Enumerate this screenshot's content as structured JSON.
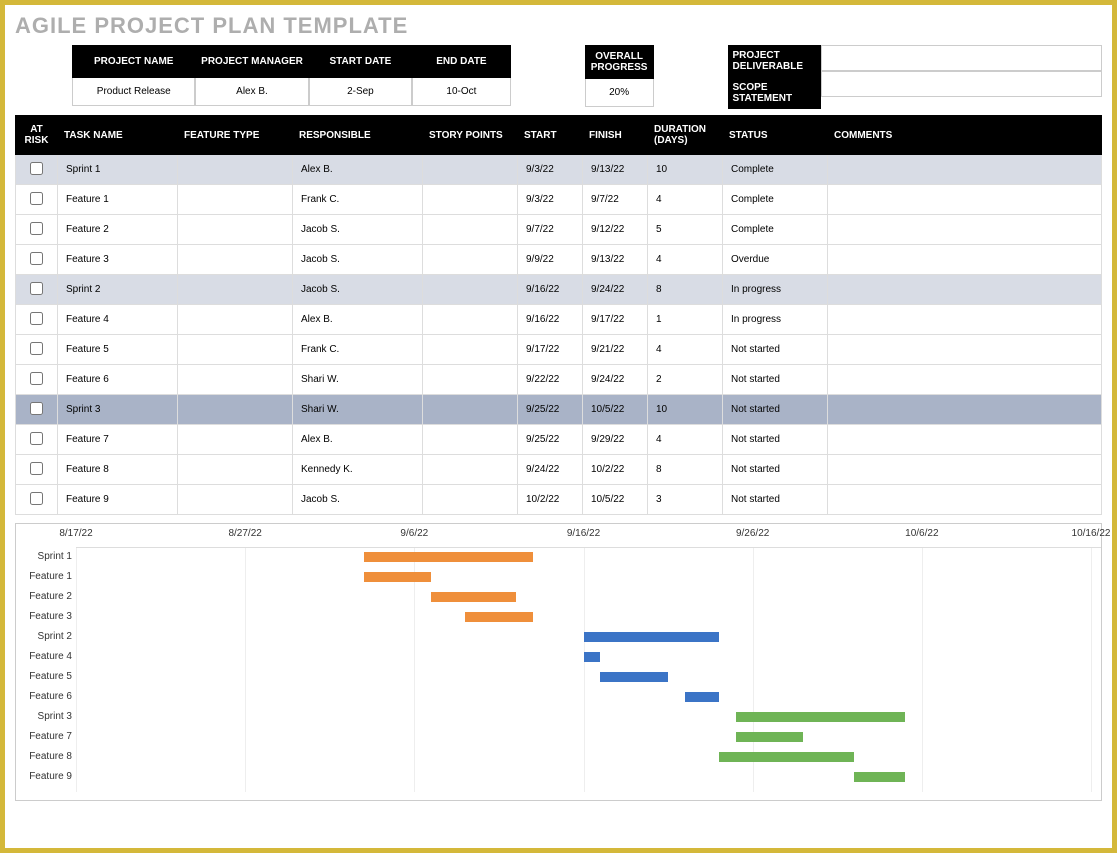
{
  "title": "AGILE PROJECT PLAN TEMPLATE",
  "header": {
    "project_name": {
      "label": "PROJECT NAME",
      "value": "Product Release"
    },
    "project_manager": {
      "label": "PROJECT MANAGER",
      "value": "Alex B."
    },
    "start_date": {
      "label": "START DATE",
      "value": "2-Sep"
    },
    "end_date": {
      "label": "END DATE",
      "value": "10-Oct"
    },
    "overall_progress": {
      "label": "OVERALL PROGRESS",
      "value": "20%"
    },
    "project_deliverable": {
      "label": "PROJECT DELIVERABLE",
      "value": ""
    },
    "scope_statement": {
      "label": "SCOPE STATEMENT",
      "value": ""
    }
  },
  "columns": {
    "at_risk": "AT RISK",
    "task_name": "TASK NAME",
    "feature_type": "FEATURE TYPE",
    "responsible": "RESPONSIBLE",
    "story_points": "STORY POINTS",
    "start": "START",
    "finish": "FINISH",
    "duration": "DURATION (DAYS)",
    "status": "STATUS",
    "comments": "COMMENTS"
  },
  "tasks": [
    {
      "type": "sprint-gray",
      "task": "Sprint 1",
      "resp": "Alex B.",
      "start": "9/3/22",
      "finish": "9/13/22",
      "dur": "10",
      "status": "Complete"
    },
    {
      "type": "",
      "task": "Feature 1",
      "resp": "Frank C.",
      "start": "9/3/22",
      "finish": "9/7/22",
      "dur": "4",
      "status": "Complete"
    },
    {
      "type": "",
      "task": "Feature 2",
      "resp": "Jacob S.",
      "start": "9/7/22",
      "finish": "9/12/22",
      "dur": "5",
      "status": "Complete"
    },
    {
      "type": "",
      "task": "Feature 3",
      "resp": "Jacob S.",
      "start": "9/9/22",
      "finish": "9/13/22",
      "dur": "4",
      "status": "Overdue"
    },
    {
      "type": "sprint-gray",
      "task": "Sprint 2",
      "resp": "Jacob S.",
      "start": "9/16/22",
      "finish": "9/24/22",
      "dur": "8",
      "status": "In progress"
    },
    {
      "type": "",
      "task": "Feature 4",
      "resp": "Alex B.",
      "start": "9/16/22",
      "finish": "9/17/22",
      "dur": "1",
      "status": "In progress"
    },
    {
      "type": "",
      "task": "Feature 5",
      "resp": "Frank C.",
      "start": "9/17/22",
      "finish": "9/21/22",
      "dur": "4",
      "status": "Not started"
    },
    {
      "type": "",
      "task": "Feature 6",
      "resp": "Shari W.",
      "start": "9/22/22",
      "finish": "9/24/22",
      "dur": "2",
      "status": "Not started"
    },
    {
      "type": "sprint-blue",
      "task": "Sprint 3",
      "resp": "Shari W.",
      "start": "9/25/22",
      "finish": "10/5/22",
      "dur": "10",
      "status": "Not started"
    },
    {
      "type": "",
      "task": "Feature 7",
      "resp": "Alex B.",
      "start": "9/25/22",
      "finish": "9/29/22",
      "dur": "4",
      "status": "Not started"
    },
    {
      "type": "",
      "task": "Feature 8",
      "resp": "Kennedy K.",
      "start": "9/24/22",
      "finish": "10/2/22",
      "dur": "8",
      "status": "Not started"
    },
    {
      "type": "",
      "task": "Feature 9",
      "resp": "Jacob S.",
      "start": "10/2/22",
      "finish": "10/5/22",
      "dur": "3",
      "status": "Not started"
    }
  ],
  "chart_data": {
    "type": "bar",
    "orientation": "horizontal-gantt",
    "x_range": [
      "8/17/22",
      "10/16/22"
    ],
    "ticks": [
      "8/17/22",
      "8/27/22",
      "9/6/22",
      "9/16/22",
      "9/26/22",
      "10/6/22",
      "10/16/22"
    ],
    "categories": [
      "Sprint 1",
      "Feature 1",
      "Feature 2",
      "Feature 3",
      "Sprint 2",
      "Feature 4",
      "Feature 5",
      "Feature 6",
      "Sprint 3",
      "Feature 7",
      "Feature 8",
      "Feature 9"
    ],
    "bars": [
      {
        "label": "Sprint 1",
        "start": "9/3/22",
        "end": "9/13/22",
        "color": "orange"
      },
      {
        "label": "Feature 1",
        "start": "9/3/22",
        "end": "9/7/22",
        "color": "orange"
      },
      {
        "label": "Feature 2",
        "start": "9/7/22",
        "end": "9/12/22",
        "color": "orange"
      },
      {
        "label": "Feature 3",
        "start": "9/9/22",
        "end": "9/13/22",
        "color": "orange"
      },
      {
        "label": "Sprint 2",
        "start": "9/16/22",
        "end": "9/24/22",
        "color": "blue"
      },
      {
        "label": "Feature 4",
        "start": "9/16/22",
        "end": "9/17/22",
        "color": "blue"
      },
      {
        "label": "Feature 5",
        "start": "9/17/22",
        "end": "9/21/22",
        "color": "blue"
      },
      {
        "label": "Feature 6",
        "start": "9/22/22",
        "end": "9/24/22",
        "color": "blue"
      },
      {
        "label": "Sprint 3",
        "start": "9/25/22",
        "end": "10/5/22",
        "color": "green"
      },
      {
        "label": "Feature 7",
        "start": "9/25/22",
        "end": "9/29/22",
        "color": "green"
      },
      {
        "label": "Feature 8",
        "start": "9/24/22",
        "end": "10/2/22",
        "color": "green"
      },
      {
        "label": "Feature 9",
        "start": "10/2/22",
        "end": "10/5/22",
        "color": "green"
      }
    ],
    "colors": {
      "orange": "#ef8f3b",
      "blue": "#3b74c6",
      "green": "#6fb456"
    }
  }
}
